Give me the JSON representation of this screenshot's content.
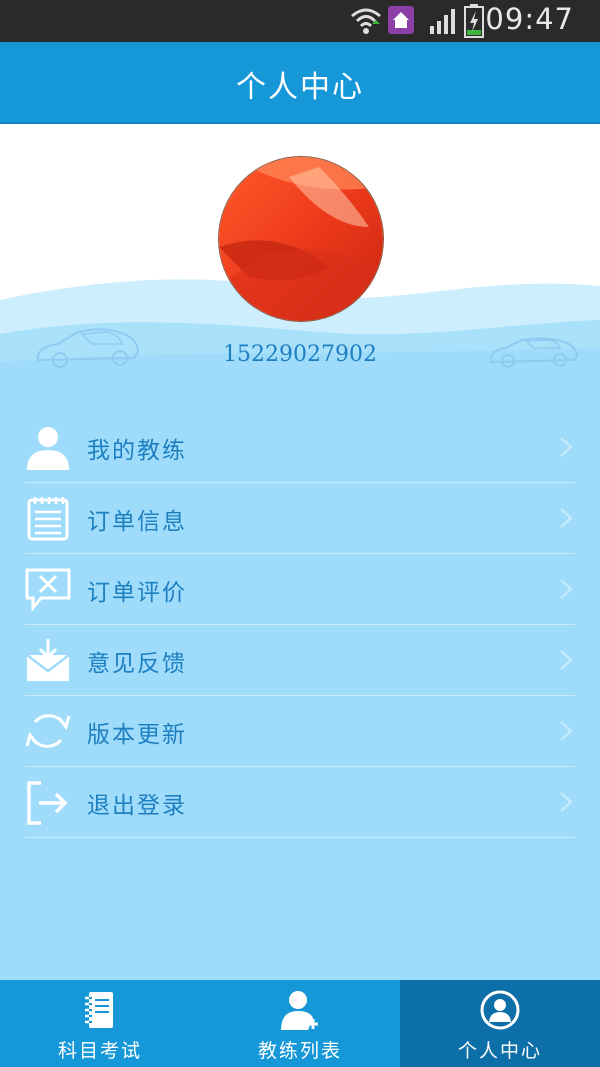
{
  "status_bar": {
    "time": "09:47"
  },
  "header": {
    "title": "个人中心"
  },
  "profile": {
    "phone": "15229027902"
  },
  "menu": {
    "items": [
      {
        "label": "我的教练",
        "icon": "person-icon"
      },
      {
        "label": "订单信息",
        "icon": "notepad-icon"
      },
      {
        "label": "订单评价",
        "icon": "chat-x-icon"
      },
      {
        "label": "意见反馈",
        "icon": "mail-download-icon"
      },
      {
        "label": "版本更新",
        "icon": "refresh-icon"
      },
      {
        "label": "退出登录",
        "icon": "logout-icon"
      }
    ]
  },
  "tabbar": {
    "tabs": [
      {
        "label": "科目考试",
        "icon": "notebook-icon"
      },
      {
        "label": "教练列表",
        "icon": "coach-add-icon"
      },
      {
        "label": "个人中心",
        "icon": "user-circle-icon",
        "active": true
      }
    ]
  },
  "colors": {
    "primary": "#1697d8",
    "active_tab": "#0c6fa8",
    "menu_bg": "#9fdcfb",
    "text": "#1e7fc0"
  }
}
